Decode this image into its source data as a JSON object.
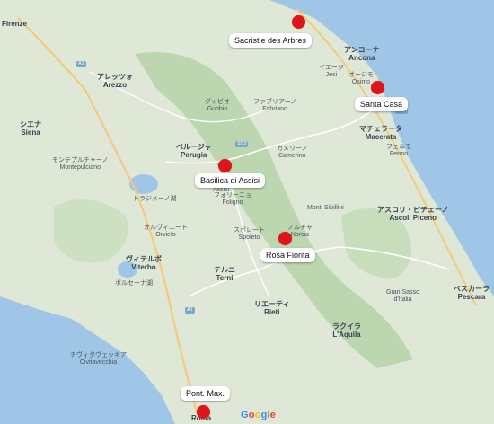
{
  "markers": [
    {
      "name": "Sacristie des Arbres",
      "marker_key": "sacristie-des-arbres"
    },
    {
      "name": "Santa Casa",
      "marker_key": "santa-casa"
    },
    {
      "name": "Basilica di Assisi",
      "marker_key": "basilica-di-assisi"
    },
    {
      "name": "Rosa Fiorita",
      "marker_key": "rosa-fiorita"
    },
    {
      "name": "Pont. Max.",
      "marker_key": "pont-max"
    }
  ],
  "places": {
    "firenze": "Firenze",
    "arezzo": "アレッツォ\nArezzo",
    "perugia": "ペルージャ\nPerugia",
    "ancona": "アンコーナ\nAncona",
    "assisi": "アッシジ\nAssisi",
    "foligno": "フォリーニョ\nFoligno",
    "spoleto": "スポレート\nSpoleto",
    "terni": "テルニ\nTerni",
    "rieti": "リエーティ\nRieti",
    "viterbo": "ヴィテルボ\nViterbo",
    "orvieto": "オルヴィエート\nOrvieto",
    "siena": "シエナ\nSiena",
    "macerata": "マチェラータ\nMacerata",
    "camerino": "カメリーノ\nCamerino",
    "norcia": "ノルチャ\nNorcia",
    "fermo": "フェルモ\nFermo",
    "ascoli": "アスコリ・ピチェーノ\nAscoli Piceno",
    "pescara": "ペスカーラ\nPescara",
    "laquila": "ラクイラ\nL'Aquila",
    "gubbio": "グッビオ\nGubbio",
    "fabriano": "ファブリアーノ\nFabriano",
    "jesi": "イエージ\nJesi",
    "osimo": "オージモ\nOsimo",
    "civitavecchia": "チヴィタヴェッキア\nCivitavecchia",
    "roma": "Roma",
    "montepulciano": "モンテプルチャーノ\nMontepulciano",
    "lago_trasimeno": "トラジメーノ湖",
    "bolsena": "ボルセーナ湖",
    "gran_sasso": "Gran Sasso\nd'Italia",
    "sibillini": "Monti Sibillini"
  },
  "google_logo": [
    "G",
    "o",
    "o",
    "g",
    "l",
    "e"
  ],
  "colors": {
    "marker": "#e0151b",
    "sea": "#9fc6e6",
    "land": "#dfe8d6",
    "forest": "#bcd7b0"
  }
}
